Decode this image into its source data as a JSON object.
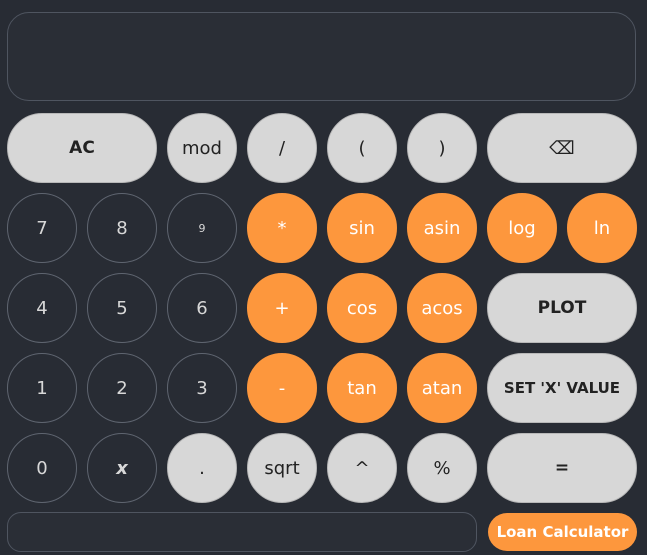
{
  "display": {
    "value": ""
  },
  "keys": {
    "ac": "AC",
    "mod": "mod",
    "divide": "/",
    "lparen": "(",
    "rparen": ")",
    "backspace": "⌫",
    "seven": "7",
    "eight": "8",
    "nine": "9",
    "multiply": "*",
    "sin": "sin",
    "asin": "asin",
    "log": "log",
    "ln": "ln",
    "four": "4",
    "five": "5",
    "six": "6",
    "plus": "+",
    "cos": "cos",
    "acos": "acos",
    "plot": "PLOT",
    "one": "1",
    "two": "2",
    "three": "3",
    "minus": "-",
    "tan": "tan",
    "atan": "atan",
    "set_x": "SET 'X' VALUE",
    "zero": "0",
    "x": "x",
    "dot": ".",
    "sqrt": "sqrt",
    "power": "^",
    "percent": "%",
    "equals": "="
  },
  "bottom": {
    "input_value": "",
    "loan_label": "Loan Calculator"
  },
  "colors": {
    "background": "#282c34",
    "accent": "#fd973d",
    "light_key": "#d7d7d7"
  }
}
